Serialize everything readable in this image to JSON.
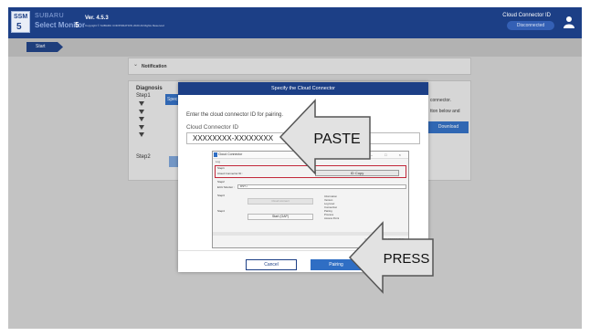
{
  "header": {
    "logo_top": "SSM",
    "logo_bottom": "5",
    "brand_line1": "SUBARU",
    "brand_line2": "Select Monitor",
    "brand_suffix": "5",
    "version": "Ver. 4.5.3",
    "copyright": "Copyright © SUBARU CORPORATION 2020 All Rights Reserved",
    "cloud_connector_label": "Cloud Connector ID",
    "cloud_connector_status": "Disconnected",
    "user_icon": "user-icon"
  },
  "nav": {
    "start_label": "Start"
  },
  "notification": {
    "label": "Notification"
  },
  "diagnosis": {
    "title": "Diagnosis",
    "step1": "Step1",
    "spec_button": "Spec",
    "step2": "Step2",
    "right_text1": "connector.",
    "right_text2": "tton below and",
    "download_button": "Download"
  },
  "modal": {
    "title": "Specify the Cloud Connector",
    "instruction": "Enter the cloud connector ID for pairing.",
    "field_label": "Cloud Connector ID",
    "field_value": "XXXXXXXX-XXXXXXXX",
    "cancel_button": "Cancel",
    "pairing_button": "Pairing"
  },
  "inner_window": {
    "app_title": "Cloud Connector",
    "controls": "– □ ×",
    "log_label": "Log",
    "step1": "Step1",
    "cc_id_label": "Cloud Connector ID :",
    "id_copy_button": "ID Copy",
    "step2": "Step2",
    "ecu_label": "ECU Monitor :",
    "ecu_value": "DST-i",
    "step3": "Step3",
    "step3_button": "Cloud connect",
    "step4": "Step4",
    "start_button": "Start (GAP)",
    "info_lines": [
      "Information",
      "Version",
      "Log level",
      "Connection",
      "Pairing",
      "Process",
      "Access Point"
    ],
    "footer": "Copyright © SUBARU CORPORATION"
  },
  "callouts": {
    "paste": "PASTE",
    "press": "PRESS"
  },
  "colors": {
    "header_bg": "#1c3f86",
    "primary_button": "#2f6ec4",
    "highlight_red": "#c2283a"
  }
}
